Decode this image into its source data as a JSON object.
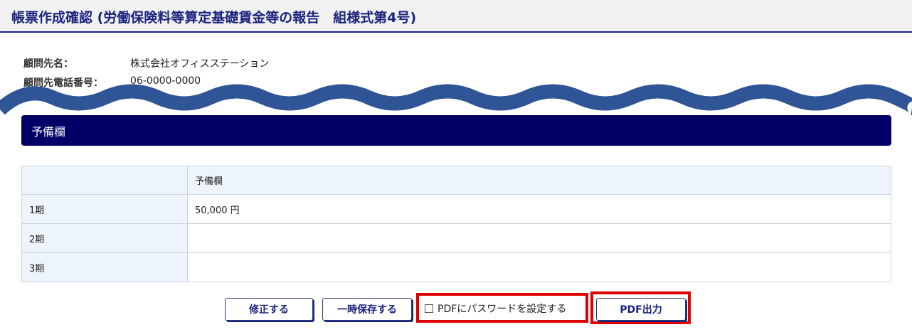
{
  "header": {
    "title": "帳票作成確認 (労働保険料等算定基礎賃金等の報告　組様式第4号)"
  },
  "client": {
    "name_label": "顧問先名：",
    "name_value": "株式会社オフィスステーション",
    "phone_label": "顧問先電話番号：",
    "phone_value": "06-0000-0000"
  },
  "section": {
    "title": "予備欄"
  },
  "table": {
    "header": [
      "",
      "予備欄"
    ],
    "rows": [
      {
        "label": "1期",
        "value": "50,000 円"
      },
      {
        "label": "2期",
        "value": ""
      },
      {
        "label": "3期",
        "value": ""
      }
    ]
  },
  "actions": {
    "edit_label": "修正する",
    "save_temp_label": "一時保存する",
    "pdf_password_label": "PDFにパスワードを設定する",
    "pdf_output_label": "PDF出力"
  },
  "colors": {
    "brand_navy": "#000066",
    "header_text": "#1a237e",
    "highlight_red": "#e00000",
    "wave_blue": "#2f5597"
  }
}
